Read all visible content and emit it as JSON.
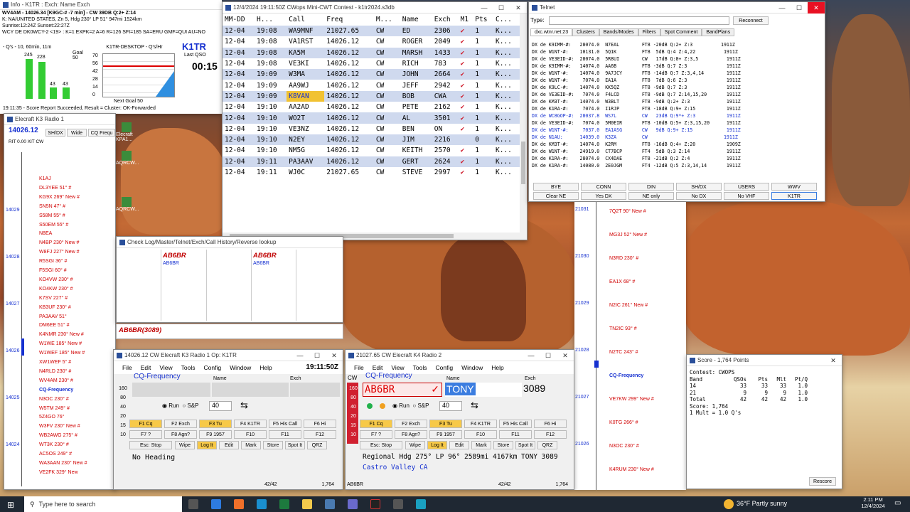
{
  "info": {
    "title": "Info - K1TR : Exch: Name Exch",
    "line1": "WV4AM - 14026.34 [K9GC-# -7 min] - CW  39DB Q:2+ Z:14",
    "line2": "K: NA/UNITED STATES, Zn 5, Hdg 230° LP 51° 947mi 1524km",
    "line3": "Sunrise:12:24Z Sunset:22:27Z",
    "line4": "WCY DE DK0WCY-2 <19> : K=1 EXPK=2 A=6 R=126 SFI=185 SA=ERU GMF=QUI AU=NO",
    "graph_title": "- Q's - 10, 60min, 11m",
    "goal_label": "Goal",
    "goal": "50",
    "host": "K1TR-DESKTOP - Q's/Hr",
    "yticks": [
      "70",
      "56",
      "42",
      "28",
      "14",
      "0"
    ],
    "bars": [
      "245",
      "228",
      "43",
      "43"
    ],
    "station": "K1TR",
    "last_qso_label": "Last QSO",
    "last_qso": "00:15",
    "next_goal": "Next Goal 50",
    "status": "19:11:35 - Score Report Succeeded, Result = Cluster: OK-Forwarded"
  },
  "log": {
    "title": "12/4/2024 19:11:50Z  CWops Mini-CWT Contest - k1tr2024.s3db",
    "headers": [
      "MM-DD",
      "H...",
      "Call",
      "Freq",
      "M...",
      "Name",
      "Exch",
      "M1",
      "Pts",
      "C..."
    ],
    "rows": [
      [
        "12-04",
        "19:08",
        "WA9MNF",
        "21027.65",
        "CW",
        "ED",
        "2306",
        "✔",
        "1",
        "K..."
      ],
      [
        "12-04",
        "19:08",
        "VA1RST",
        "14026.12",
        "CW",
        "ROGER",
        "2049",
        "✔",
        "1",
        "K..."
      ],
      [
        "12-04",
        "19:08",
        "KA5M",
        "14026.12",
        "CW",
        "MARSH",
        "1433",
        "✔",
        "1",
        "K..."
      ],
      [
        "12-04",
        "19:08",
        "VE3KI",
        "14026.12",
        "CW",
        "RICH",
        "783",
        "✔",
        "1",
        "K..."
      ],
      [
        "12-04",
        "19:09",
        "W3MA",
        "14026.12",
        "CW",
        "JOHN",
        "2664",
        "✔",
        "1",
        "K..."
      ],
      [
        "12-04",
        "19:09",
        "AA9WJ",
        "14026.12",
        "CW",
        "JEFF",
        "2942",
        "✔",
        "1",
        "K..."
      ],
      [
        "12-04",
        "19:09",
        "K8VAN",
        "14026.12",
        "CW",
        "BOB",
        "CWA",
        "✔",
        "1",
        "K..."
      ],
      [
        "12-04",
        "19:10",
        "AA2AD",
        "14026.12",
        "CW",
        "PETE",
        "2162",
        "✔",
        "1",
        "K..."
      ],
      [
        "12-04",
        "19:10",
        "WO2T",
        "14026.12",
        "CW",
        "AL",
        "3501",
        "✔",
        "1",
        "K..."
      ],
      [
        "12-04",
        "19:10",
        "VE3NZ",
        "14026.12",
        "CW",
        "BEN",
        "ON",
        "✔",
        "1",
        "K..."
      ],
      [
        "12-04",
        "19:10",
        "N2EY",
        "14026.12",
        "CW",
        "JIM",
        "2216",
        "",
        "0",
        "K..."
      ],
      [
        "12-04",
        "19:10",
        "NM5G",
        "14026.12",
        "CW",
        "KEITH",
        "2570",
        "✔",
        "1",
        "K..."
      ],
      [
        "12-04",
        "19:11",
        "PA3AAV",
        "14026.12",
        "CW",
        "GERT",
        "2624",
        "✔",
        "1",
        "K..."
      ],
      [
        "12-04",
        "19:11",
        "WJ0C",
        "21027.65",
        "CW",
        "STEVE",
        "2997",
        "✔",
        "1",
        "K..."
      ]
    ]
  },
  "telnet": {
    "title": "Telnet",
    "type_label": "Type:",
    "reconnect": "Reconnect",
    "tabs": [
      "dxc.wtnr.net:23",
      "Clusters",
      "Bands/Modes",
      "Filters",
      "Spot Comment",
      "BandPlans"
    ],
    "lines": [
      "DX de K9IMM-#:   28074.0  N7EAL        FT8 -20dB Q:2+ Z:3          1911Z",
      "DX de W1NT-#:    10131.0  5Q1K         FT8  5dB Q:4 Z:4,22          1911Z",
      "DX de VE3EID-#:  28074.0  5R8UI        CW   17dB Q:8+ Z:3,5          1911Z",
      "DX de K9IMM-#:   14074.0  AA6B         FT8 -3dB Q:7 Z:3              1911Z",
      "DX de W1NT-#:    14074.0  9A7JCY       FT8 -14dB Q:7 Z:3,4,14        1911Z",
      "DX de W1NT-#:     7074.0  EA1A         FT8  7dB Q:6 Z:3              1911Z",
      "DX de K9LC-#:    14074.0  KK5QZ        FT8 -9dB Q:7 Z:3              1911Z",
      "DX de VE3EID-#:   7074.0  F4LCD        FT8 -9dB Q:7 Z:14,15,20       1911Z",
      "DX de KM3T-#:    14074.0  W3BLT        FT8 -9dB Q:2+ Z:3             1911Z",
      "DX de K1RA-#:     7074.0  I1RJP        FT8 -18dB Q:9+ Z:15           1911Z",
      "DX de WC8GOP-#:  28037.8  WS7L         CW   23dB Q:9*+ Z:3           1911Z",
      "DX de VE3EID-#:   7074.0  5M0EIR       FT8 -10dB Q:5+ Z:3,15,20      1911Z",
      "DX de W1NT-#:     7037.0  EA1ASG       CW   9dB Q:9+ Z:15            1911Z",
      "DX de N1AU:      14039.0  K3ZA         CW                           1911Z",
      "DX de KM3T-#:    14074.0  K2RM         FT8 -16dB Q:4+ Z:20           1909Z",
      "DX de W1NT-#:    24919.0  CT7BCP       FT4  5dB Q:3 Z:14             1911Z",
      "DX de K1RA-#:    28074.0  CX4DAE       FT8 -21dB Q:2 Z:4             1911Z",
      "DX de K1RA-#:    14080.0  2E0JGM       FT4 -12dB Q:5 Z:3,14,14       1911Z"
    ],
    "blue_rows": [
      10,
      12,
      13
    ],
    "buttons": [
      "BYE",
      "CONN",
      "DIN",
      "SH/DX",
      "USERS",
      "WWV",
      "Clear NE",
      "Yes DX",
      "NE only",
      "No DX",
      "No VHF",
      "K1TR"
    ]
  },
  "bandmap1": {
    "title": "Elecraft K3 Radio 1",
    "freq": "14026.12",
    "buttons": [
      "SH/DX",
      "Wide",
      "CQ Frequ"
    ],
    "rt": "RIT",
    "rt_val": "0.00",
    "xit": "XIT",
    "mode": "CW",
    "labels": [
      "14029",
      "14028",
      "14027",
      "14026",
      "14025",
      "14024"
    ],
    "spots": [
      "K1AJ",
      "DL3YEE 51° #",
      "KG9X 269° New #",
      "SN5N 47° #",
      "S58M 55° #",
      "S50EM 55° #",
      "N8EA",
      "N4BP 230° New #",
      "W8FJ 227° New #",
      "R5SGI 36° #",
      "F5SGI 60° #",
      "KO4VW 230° #",
      "KO4KW 230° #",
      "K7SV 227° #",
      "KB3UF 230° #",
      "PA3AAV 51°",
      "DM6EE 51° #",
      "K4NMR 230° New #",
      "W1WE 185° New #",
      "W1WEF 185° New #",
      "XW1WEF 5° #",
      "N4RLD 230° #",
      "WV4AM 230° #",
      "CQ-Frequency",
      "N3OC 230° #",
      "W5TM 249° #",
      "5Z4GO 76°",
      "W3FV 230° New #",
      "WB2AWG 275° #",
      "WT3K 230° #",
      "AC5OS 249° #",
      "WA3AAN 230° New #",
      "VE2FK 329° New"
    ]
  },
  "bandmap2": {
    "labels": [
      "21031",
      "21030",
      "21029",
      "21028",
      "21027",
      "21026"
    ],
    "spots": [
      "7Q2T 90° New #",
      "MG3J 52° New #",
      "N3RD 230° #",
      "EA1X 68° #",
      "N2IC 261° New #",
      "TN2IC 93° #",
      "N2TC 243° #",
      "CQ-Frequency",
      "VE7KW 299° New #",
      "K0TG 266° #",
      "N3OC 230° #",
      "K4RUM 230° New #"
    ]
  },
  "desktop_icons": [
    "Elecraft KPA1...",
    "AQRCW...",
    "AQRCW..."
  ],
  "check": {
    "title": "Check Log/Master/Telnet/Exch/Call History/Reverse lookup",
    "call1": "AB6BR",
    "sub1": "AB6BR",
    "call2": "AB6BR",
    "sub2": "AB6BR",
    "hist": "AB6BR(3089)"
  },
  "radio1": {
    "title": "14026.12 CW Elecraft K3 Radio 1    Op: K1TR",
    "time": "19:11:50Z",
    "menu": [
      "File",
      "Edit",
      "View",
      "Tools",
      "Config",
      "Window",
      "Help"
    ],
    "cq": "CQ-Frequency",
    "name_label": "Name",
    "exch_label": "Exch",
    "bands": [
      "160",
      "80",
      "40",
      "20",
      "15",
      "10"
    ],
    "run": "Run",
    "sp": "S&P",
    "speed": "40",
    "fkeys": [
      "F1 Cq",
      "F2 Exch",
      "F3 Tu",
      "F4 K1TR",
      "F5 His Call",
      "F6 Hi",
      "F7 ?",
      "F8 Agn?",
      "F9 1957",
      "F10",
      "F11",
      "F12",
      "Esc: Stop",
      "Wipe",
      "Log It",
      "Edit",
      "Mark",
      "Store",
      "Spot It",
      "QRZ"
    ],
    "status": "No Heading",
    "count": "42/42",
    "score": "1,764"
  },
  "radio2": {
    "title": "21027.65 CW Elecraft K4 Radio 2",
    "menu": [
      "File",
      "Edit",
      "View",
      "Tools",
      "Config",
      "Window",
      "Help"
    ],
    "mode": "CW",
    "cq": "CQ-Frequency",
    "name_label": "Name",
    "exch_label": "Exch",
    "call": "AB6BR",
    "name": "TONY",
    "exch": "3089",
    "bands": [
      "160",
      "80",
      "40",
      "20",
      "15",
      "10"
    ],
    "run": "Run",
    "sp": "S&P",
    "speed": "40",
    "fkeys": [
      "F1 Cq",
      "F2 Exch",
      "F3 Tu",
      "F4 K1TR",
      "F5 His Call",
      "F6 Hi",
      "F7 ?",
      "F8 Agn?",
      "F9 1957",
      "F10",
      "F11",
      "F12",
      "Esc: Stop",
      "Wipe",
      "Log It",
      "Edit",
      "Mark",
      "Store",
      "Spot It",
      "QRZ"
    ],
    "info": "Regional Hdg 275° LP 96° 2589mi 4167km TONY 3089",
    "qth": "Castro Valley CA",
    "status_call": "AB6BR",
    "count": "42/42",
    "score": "1,764"
  },
  "score": {
    "title": "Score - 1,764 Points",
    "contest": "Contest: CWOPS",
    "cols": [
      "Band",
      "QSOs",
      "Pts",
      "Mlt",
      "Pt/Q"
    ],
    "rows": [
      [
        "14",
        "33",
        "33",
        "33",
        "1.0"
      ],
      [
        "21",
        "9",
        "9",
        "9",
        "1.0"
      ],
      [
        "Total",
        "42",
        "42",
        "42",
        "1.0"
      ]
    ],
    "score": "Score: 1,764",
    "mult": "1 Mult = 1.0 Q's",
    "rescore": "Rescore"
  },
  "taskbar": {
    "search": "Type here to search",
    "weather": "36°F  Partly sunny",
    "time": "2:11 PM",
    "date": "12/4/2024"
  }
}
